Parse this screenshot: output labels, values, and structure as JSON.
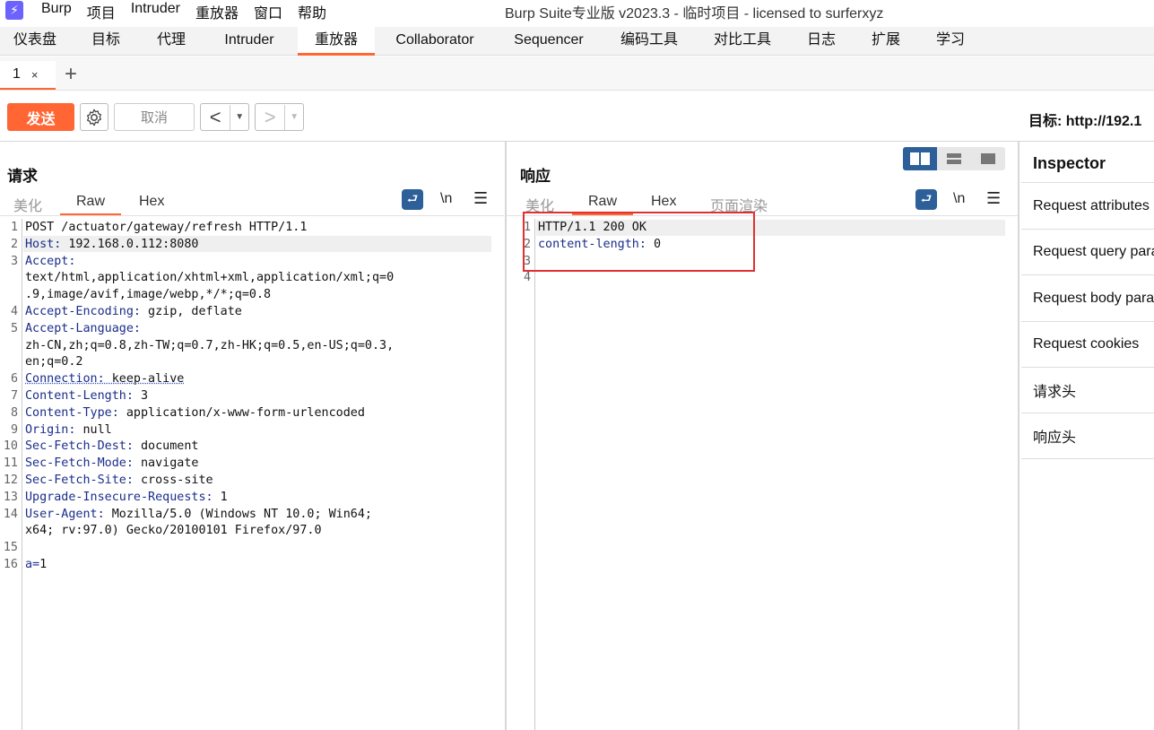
{
  "titlebar": {
    "app_icon": "burp-lightning-icon",
    "menu": [
      "Burp",
      "项目",
      "Intruder",
      "重放器",
      "窗口",
      "帮助"
    ],
    "window_title": "Burp Suite专业版  v2023.3 - 临时项目 - licensed to surferxyz"
  },
  "main_tabs": [
    "仪表盘",
    "目标",
    "代理",
    "Intruder",
    "重放器",
    "Collaborator",
    "Sequencer",
    "编码工具",
    "对比工具",
    "日志",
    "扩展",
    "学习"
  ],
  "active_main_tab": "重放器",
  "sub_tabs": [
    {
      "label": "1",
      "close": "×"
    }
  ],
  "add_tab": "+",
  "toolbar": {
    "send": "发送",
    "cancel": "取消",
    "back": "<",
    "forward": ">",
    "dropdown": "▼",
    "target": "目标: http://192.1"
  },
  "request": {
    "title": "请求",
    "tabs": [
      "美化",
      "Raw",
      "Hex"
    ],
    "active_tab": "Raw",
    "newline_toggle": "\\n",
    "menu": "☰",
    "line_numbers": [
      "1",
      "2",
      "3",
      "",
      "",
      "4",
      "5",
      "",
      "",
      "6",
      "7",
      "8",
      "9",
      "10",
      "11",
      "12",
      "13",
      "14",
      "",
      "15",
      "16"
    ],
    "lines": [
      {
        "k": "",
        "v": "POST /actuator/gateway/refresh HTTP/1.1"
      },
      {
        "k": "Host:",
        "v": " 192.168.0.112:8080"
      },
      {
        "k": "Accept:",
        "v": ""
      },
      {
        "k": "",
        "v": "text/html,application/xhtml+xml,application/xml;q=0"
      },
      {
        "k": "",
        "v": ".9,image/avif,image/webp,*/*;q=0.8"
      },
      {
        "k": "Accept-Encoding:",
        "v": " gzip, deflate"
      },
      {
        "k": "Accept-Language:",
        "v": ""
      },
      {
        "k": "",
        "v": "zh-CN,zh;q=0.8,zh-TW;q=0.7,zh-HK;q=0.5,en-US;q=0.3,"
      },
      {
        "k": "",
        "v": "en;q=0.2"
      },
      {
        "k": "Connection:",
        "v": " keep-alive"
      },
      {
        "k": "Content-Length:",
        "v": " 3"
      },
      {
        "k": "Content-Type:",
        "v": " application/x-www-form-urlencoded"
      },
      {
        "k": "Origin:",
        "v": " null"
      },
      {
        "k": "Sec-Fetch-Dest:",
        "v": " document"
      },
      {
        "k": "Sec-Fetch-Mode:",
        "v": " navigate"
      },
      {
        "k": "Sec-Fetch-Site:",
        "v": " cross-site"
      },
      {
        "k": "Upgrade-Insecure-Requests:",
        "v": " 1"
      },
      {
        "k": "User-Agent:",
        "v": " Mozilla/5.0 (Windows NT 10.0; Win64;"
      },
      {
        "k": "",
        "v": "x64; rv:97.0) Gecko/20100101 Firefox/97.0"
      },
      {
        "k": "",
        "v": ""
      },
      {
        "k": "a=",
        "v": "1"
      }
    ]
  },
  "response": {
    "title": "响应",
    "tabs": [
      "美化",
      "Raw",
      "Hex",
      "页面渲染"
    ],
    "active_tab": "Raw",
    "newline_toggle": "\\n",
    "menu": "☰",
    "line_numbers": [
      "1",
      "2",
      "3",
      "4"
    ],
    "lines": [
      {
        "k": "",
        "v": "HTTP/1.1 200 OK"
      },
      {
        "k": "content-length:",
        "v": " 0"
      },
      {
        "k": "",
        "v": ""
      },
      {
        "k": "",
        "v": ""
      }
    ]
  },
  "inspector": {
    "title": "Inspector",
    "items": [
      "Request attributes",
      "Request query parameters",
      "Request body parameters",
      "Request cookies",
      "请求头",
      "响应头"
    ]
  },
  "colors": {
    "accent": "#ff6633",
    "header_key": "#1a2e8a",
    "highlight_box": "#e03030",
    "toggle_active": "#2d5f99"
  }
}
